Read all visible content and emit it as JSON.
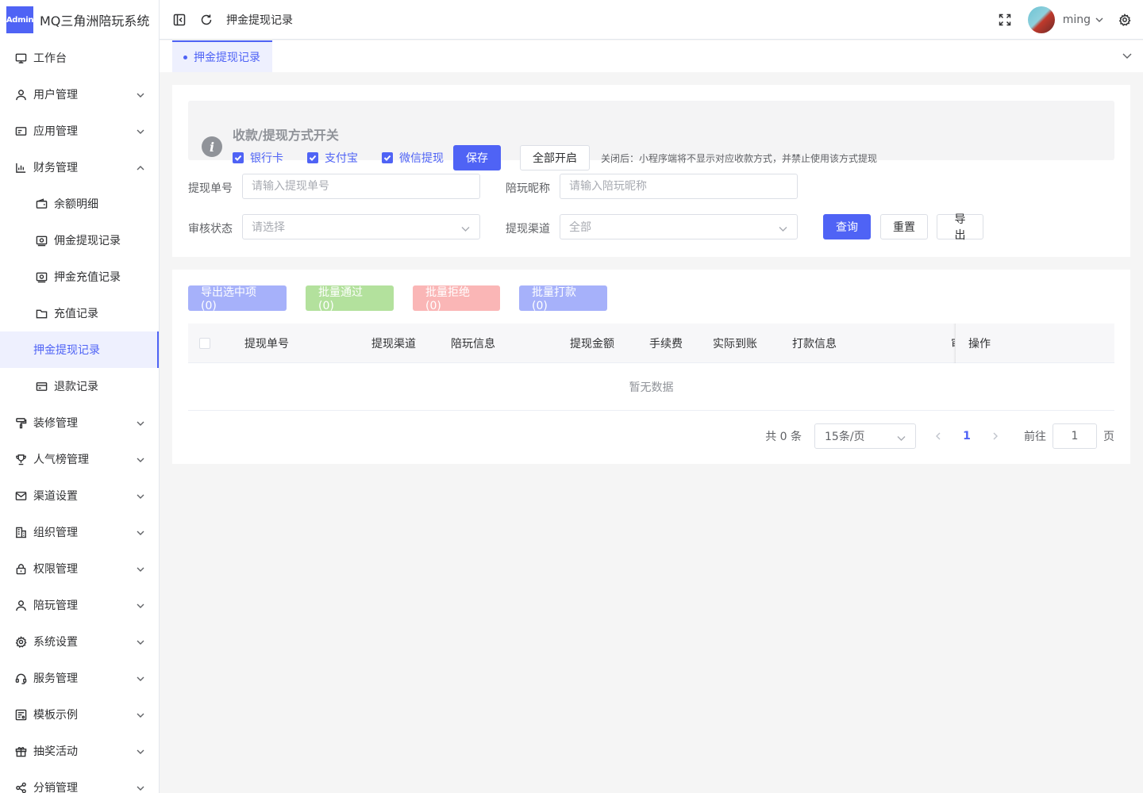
{
  "app": {
    "logo_badge": "Admin",
    "title": "MQ三角洲陪玩系统"
  },
  "sidebar": {
    "items": [
      {
        "label": "工作台"
      },
      {
        "label": "用户管理"
      },
      {
        "label": "应用管理"
      },
      {
        "label": "财务管理"
      },
      {
        "label": "余额明细"
      },
      {
        "label": "佣金提现记录"
      },
      {
        "label": "押金充值记录"
      },
      {
        "label": "充值记录"
      },
      {
        "label": "押金提现记录"
      },
      {
        "label": "退款记录"
      },
      {
        "label": "装修管理"
      },
      {
        "label": "人气榜管理"
      },
      {
        "label": "渠道设置"
      },
      {
        "label": "组织管理"
      },
      {
        "label": "权限管理"
      },
      {
        "label": "陪玩管理"
      },
      {
        "label": "系统设置"
      },
      {
        "label": "服务管理"
      },
      {
        "label": "模板示例"
      },
      {
        "label": "抽奖活动"
      },
      {
        "label": "分销管理"
      }
    ]
  },
  "header": {
    "breadcrumb": "押金提现记录",
    "username": "ming"
  },
  "tabs": [
    {
      "label": "押金提现记录"
    }
  ],
  "switches": {
    "title": "收款/提现方式开关",
    "options": [
      {
        "label": "银行卡",
        "checked": true
      },
      {
        "label": "支付宝",
        "checked": true
      },
      {
        "label": "微信提现",
        "checked": true
      }
    ],
    "save_label": "保存",
    "enable_all_label": "全部开启",
    "note": "关闭后：小程序端将不显示对应收款方式，并禁止使用该方式提现"
  },
  "filters": {
    "order_no": {
      "label": "提现单号",
      "placeholder": "请输入提现单号"
    },
    "nickname": {
      "label": "陪玩昵称",
      "placeholder": "请输入陪玩昵称"
    },
    "status": {
      "label": "审核状态",
      "placeholder": "请选择"
    },
    "channel": {
      "label": "提现渠道",
      "value": "全部"
    },
    "query_label": "查询",
    "reset_label": "重置",
    "export_label": "导出"
  },
  "batch": {
    "export_selected": "导出选中项 (0)",
    "approve": "批量通过 (0)",
    "reject": "批量拒绝 (0)",
    "pay": "批量打款 (0)"
  },
  "table": {
    "columns": [
      "提现单号",
      "提现渠道",
      "陪玩信息",
      "提现金额",
      "手续费",
      "实际到账",
      "打款信息",
      "审",
      "操作"
    ],
    "empty_text": "暂无数据"
  },
  "pagination": {
    "total_text": "共 0 条",
    "page_size": "15条/页",
    "current_page": "1",
    "goto_label": "前往",
    "goto_value": "1",
    "page_suffix": "页"
  },
  "colors": {
    "primary": "#4f63f5",
    "batch_export": "#a6b1fa",
    "batch_approve": "#b3e19d",
    "batch_reject": "#fab6b6",
    "batch_pay": "#a6b1fa"
  }
}
